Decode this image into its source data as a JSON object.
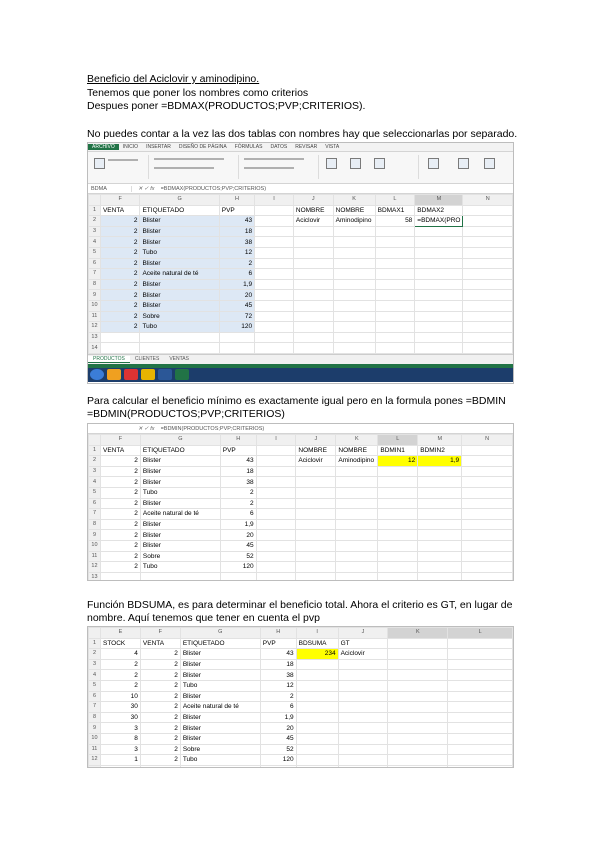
{
  "text": {
    "title": "Beneficio del Aciclovir y aminodipino.",
    "p1": "Tenemos que poner los nombres como criterios",
    "p2": "Despues poner =BDMAX(PRODUCTOS;PVP;CRITERIOS).",
    "p3": "No puedes contar a la vez las dos tablas con nombres hay que seleccionarlas por separado.",
    "p4a": "Para calcular el beneficio mínimo es exactamente igual pero en la formula pones =BDMIN",
    "p4b": "=BDMIN(PRODUCTOS;PVP;CRITERIOS)",
    "p5a": "Función BDSUMA, es para determinar el beneficio total. Ahora el criterio es GT, en lugar de",
    "p5b": "nombre. Aquí tenemos que tener en cuenta el pvp"
  },
  "shot1": {
    "tabs": [
      "ARCHIVO",
      "INICIO",
      "INSERTAR",
      "DISEÑO DE PÁGINA",
      "FÓRMULAS",
      "DATOS",
      "REVISAR",
      "VISTA"
    ],
    "namebox": "BDMA",
    "formula": "=BDMAX(PRODUCTOS;PVP;CRITERIOS)",
    "cols": [
      "",
      "F",
      "G",
      "H",
      "I",
      "J",
      "K",
      "L",
      "M",
      "N"
    ],
    "rows": [
      [
        "1",
        "VENTA",
        "ETIQUETADO",
        "PVP",
        "",
        "NOMBRE",
        "NOMBRE",
        "BDMAX1",
        "BDMAX2",
        ""
      ],
      [
        "2",
        "2",
        "Blister",
        "43",
        "",
        "Aciclovir",
        "Aminodipino",
        "58",
        "=BDMAX(PRO",
        ""
      ],
      [
        "3",
        "2",
        "Blister",
        "18",
        "",
        "",
        "",
        "",
        "",
        ""
      ],
      [
        "4",
        "2",
        "Blister",
        "38",
        "",
        "",
        "",
        "",
        "",
        ""
      ],
      [
        "5",
        "2",
        "Tubo",
        "12",
        "",
        "",
        "",
        "",
        "",
        ""
      ],
      [
        "6",
        "2",
        "Blister",
        "2",
        "",
        "",
        "",
        "",
        "",
        ""
      ],
      [
        "7",
        "2",
        "Aceite natural de té",
        "6",
        "",
        "",
        "",
        "",
        "",
        ""
      ],
      [
        "8",
        "2",
        "Blister",
        "1,9",
        "",
        "",
        "",
        "",
        "",
        ""
      ],
      [
        "9",
        "2",
        "Blister",
        "20",
        "",
        "",
        "",
        "",
        "",
        ""
      ],
      [
        "10",
        "2",
        "Blister",
        "45",
        "",
        "",
        "",
        "",
        "",
        ""
      ],
      [
        "11",
        "2",
        "Sobre",
        "72",
        "",
        "",
        "",
        "",
        "",
        ""
      ],
      [
        "12",
        "2",
        "Tubo",
        "120",
        "",
        "",
        "",
        "",
        "",
        ""
      ],
      [
        "13",
        "",
        "",
        "",
        "",
        "",
        "",
        "",
        "",
        ""
      ],
      [
        "14",
        "",
        "",
        "",
        "",
        "",
        "",
        "",
        "",
        ""
      ]
    ],
    "sheets": [
      "PRODUCTOS",
      "CLIENTES",
      "VENTAS"
    ]
  },
  "shot2": {
    "formula": "=BDMIN(PRODUCTOS;PVP;CRITERIOS)",
    "cols": [
      "",
      "F",
      "G",
      "H",
      "I",
      "J",
      "K",
      "L",
      "M",
      "N"
    ],
    "rows": [
      [
        "1",
        "VENTA",
        "ETIQUETADO",
        "PVP",
        "",
        "NOMBRE",
        "NOMBRE",
        "BDMIN1",
        "BDMIN2",
        ""
      ],
      [
        "2",
        "2",
        "Blister",
        "43",
        "",
        "Aciclovir",
        "Aminodipino",
        "12",
        "1,9",
        ""
      ],
      [
        "3",
        "2",
        "Blister",
        "18",
        "",
        "",
        "",
        "",
        "",
        ""
      ],
      [
        "4",
        "2",
        "Blister",
        "38",
        "",
        "",
        "",
        "",
        "",
        ""
      ],
      [
        "5",
        "2",
        "Tubo",
        "2",
        "",
        "",
        "",
        "",
        "",
        ""
      ],
      [
        "6",
        "2",
        "Blister",
        "2",
        "",
        "",
        "",
        "",
        "",
        ""
      ],
      [
        "7",
        "2",
        "Aceite natural de té",
        "6",
        "",
        "",
        "",
        "",
        "",
        ""
      ],
      [
        "8",
        "2",
        "Blister",
        "1,9",
        "",
        "",
        "",
        "",
        "",
        ""
      ],
      [
        "9",
        "2",
        "Blister",
        "20",
        "",
        "",
        "",
        "",
        "",
        ""
      ],
      [
        "10",
        "2",
        "Blister",
        "45",
        "",
        "",
        "",
        "",
        "",
        ""
      ],
      [
        "11",
        "2",
        "Sobre",
        "52",
        "",
        "",
        "",
        "",
        "",
        ""
      ],
      [
        "12",
        "2",
        "Tubo",
        "120",
        "",
        "",
        "",
        "",
        "",
        ""
      ],
      [
        "13",
        "",
        "",
        "",
        "",
        "",
        "",
        "",
        "",
        ""
      ]
    ]
  },
  "shot3": {
    "cols": [
      "",
      "E",
      "F",
      "G",
      "H",
      "I",
      "J",
      "K",
      "L"
    ],
    "rows": [
      [
        "1",
        "STOCK",
        "VENTA",
        "ETIQUETADO",
        "PVP",
        "BDSUMA",
        "GT",
        "",
        ""
      ],
      [
        "2",
        "4",
        "2",
        "Blister",
        "43",
        "234",
        "Aciclovir",
        "",
        ""
      ],
      [
        "3",
        "2",
        "2",
        "Blister",
        "18",
        "",
        "",
        "",
        ""
      ],
      [
        "4",
        "2",
        "2",
        "Blister",
        "38",
        "",
        "",
        "",
        ""
      ],
      [
        "5",
        "2",
        "2",
        "Tubo",
        "12",
        "",
        "",
        "",
        ""
      ],
      [
        "6",
        "10",
        "2",
        "Blister",
        "2",
        "",
        "",
        "",
        ""
      ],
      [
        "7",
        "30",
        "2",
        "Aceite natural de té",
        "6",
        "",
        "",
        "",
        ""
      ],
      [
        "8",
        "30",
        "2",
        "Blister",
        "1,9",
        "",
        "",
        "",
        ""
      ],
      [
        "9",
        "3",
        "2",
        "Blister",
        "20",
        "",
        "",
        "",
        ""
      ],
      [
        "10",
        "8",
        "2",
        "Blister",
        "45",
        "",
        "",
        "",
        ""
      ],
      [
        "11",
        "3",
        "2",
        "Sobre",
        "52",
        "",
        "",
        "",
        ""
      ],
      [
        "12",
        "1",
        "2",
        "Tubo",
        "120",
        "",
        "",
        "",
        ""
      ],
      [
        "13",
        "",
        "",
        "",
        "",
        "",
        "",
        "",
        ""
      ]
    ]
  },
  "colors": {
    "excel_green": "#217346",
    "yellow_highlight": "#ffff00",
    "selection_blue": "#dde8f5"
  }
}
